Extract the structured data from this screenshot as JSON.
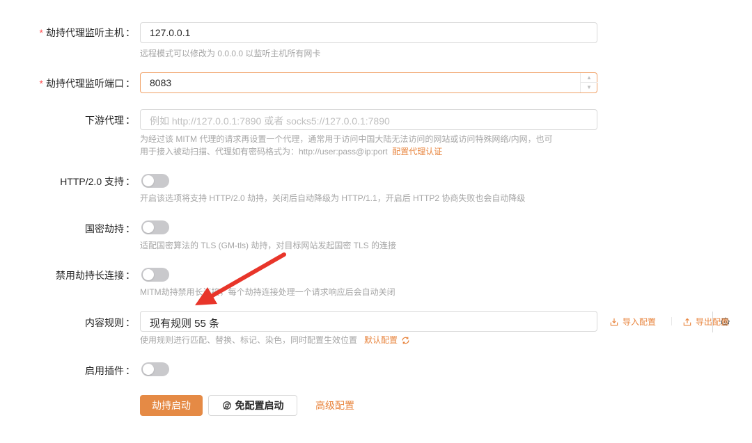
{
  "form": {
    "host": {
      "required": "*",
      "label": "劫持代理监听主机",
      "value": "127.0.0.1",
      "help": "远程模式可以修改为 0.0.0.0 以监听主机所有网卡"
    },
    "port": {
      "required": "*",
      "label": "劫持代理监听端口",
      "value": "8083"
    },
    "downstream": {
      "label": "下游代理",
      "placeholder": "例如 http://127.0.0.1:7890 或者 socks5://127.0.0.1:7890",
      "help_line1": "为经过该 MITM 代理的请求再设置一个代理，通常用于访问中国大陆无法访问的网站或访问特殊网络/内网，也可",
      "help_line2": "用于接入被动扫描、代理如有密码格式为：http://user:pass@ip:port",
      "help_link": "配置代理认证"
    },
    "http2": {
      "label": "HTTP/2.0 支持",
      "enabled": false,
      "help": "开启该选项将支持 HTTP/2.0 劫持，关闭后自动降级为 HTTP/1.1，开启后 HTTP2 协商失败也会自动降级"
    },
    "gm": {
      "label": "国密劫持",
      "enabled": false,
      "help": "适配国密算法的 TLS (GM-tls) 劫持，对目标网站发起国密 TLS 的连接"
    },
    "keepalive": {
      "label": "禁用劫持长连接",
      "enabled": false,
      "help": "MITM劫持禁用长连接，每个劫持连接处理一个请求响应后会自动关闭"
    },
    "rules": {
      "label": "内容规则",
      "value": "现有规则 55 条",
      "import_label": "导入配置",
      "export_label": "导出配置",
      "help": "使用规则进行匹配、替换、标记、染色，同时配置生效位置",
      "help_link": "默认配置"
    },
    "plugins": {
      "label": "启用插件",
      "enabled": false
    },
    "colon": "："
  },
  "actions": {
    "start_label": "劫持启动",
    "no_config_start_label": "免配置启动",
    "advanced_label": "高级配置"
  },
  "colors": {
    "accent": "#e58a45",
    "link": "#e8843d",
    "required": "#ff4d4f",
    "arrow": "#e8352a"
  }
}
